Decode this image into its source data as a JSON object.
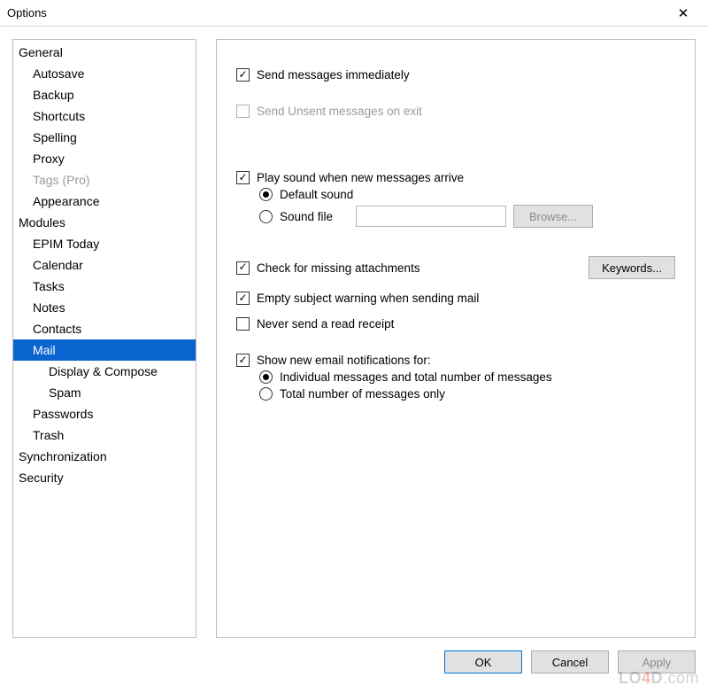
{
  "window": {
    "title": "Options"
  },
  "tree": {
    "general": "General",
    "autosave": "Autosave",
    "backup": "Backup",
    "shortcuts": "Shortcuts",
    "spelling": "Spelling",
    "proxy": "Proxy",
    "tags_pro": "Tags (Pro)",
    "appearance": "Appearance",
    "modules": "Modules",
    "epim_today": "EPIM Today",
    "calendar": "Calendar",
    "tasks": "Tasks",
    "notes": "Notes",
    "contacts": "Contacts",
    "mail": "Mail",
    "display_compose": "Display & Compose",
    "spam": "Spam",
    "passwords": "Passwords",
    "trash": "Trash",
    "synchronization": "Synchronization",
    "security": "Security"
  },
  "mail": {
    "send_immediately": "Send messages immediately",
    "send_unsent_on_exit": "Send Unsent messages on exit",
    "play_sound": "Play sound when new messages arrive",
    "default_sound": "Default sound",
    "sound_file": "Sound file",
    "browse": "Browse...",
    "check_attachments": "Check for missing attachments",
    "keywords": "Keywords...",
    "empty_subject": "Empty subject warning when sending mail",
    "never_read_receipt": "Never send a read receipt",
    "show_notifications": "Show new email notifications for:",
    "individual_msgs": "Individual messages and total number of messages",
    "total_only": "Total number of messages only"
  },
  "footer": {
    "ok": "OK",
    "cancel": "Cancel",
    "apply": "Apply"
  },
  "watermark": "LO4D.com"
}
